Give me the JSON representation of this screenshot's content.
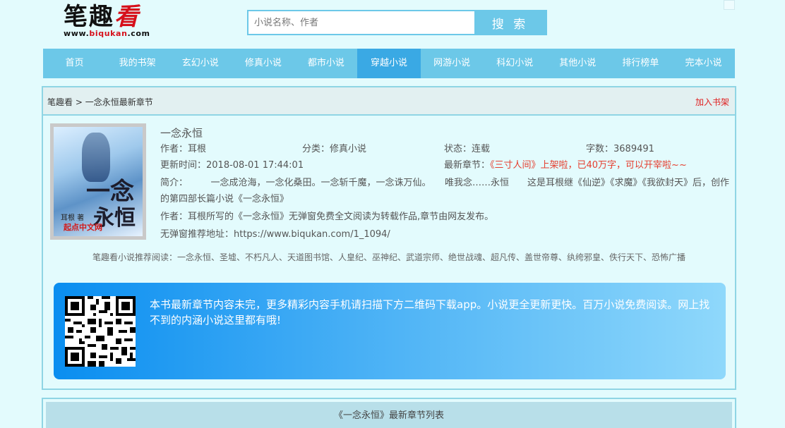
{
  "site": {
    "logo_text_black": "笔趣",
    "logo_text_red": "看",
    "logo_url_prefix": "www.",
    "logo_url_red": "biqukan",
    "logo_url_suffix": ".com"
  },
  "search": {
    "placeholder": "小说名称、作者",
    "button_label": "搜 索"
  },
  "nav": {
    "items": [
      {
        "label": "首页",
        "active": false
      },
      {
        "label": "我的书架",
        "active": false
      },
      {
        "label": "玄幻小说",
        "active": false
      },
      {
        "label": "修真小说",
        "active": false
      },
      {
        "label": "都市小说",
        "active": false
      },
      {
        "label": "穿越小说",
        "active": true
      },
      {
        "label": "网游小说",
        "active": false
      },
      {
        "label": "科幻小说",
        "active": false
      },
      {
        "label": "其他小说",
        "active": false
      },
      {
        "label": "排行榜单",
        "active": false
      },
      {
        "label": "完本小说",
        "active": false
      }
    ]
  },
  "breadcrumb": {
    "home": "笔趣看",
    "separator": " > ",
    "current": "一念永恒最新章节"
  },
  "add_shelf": "加入书架",
  "book": {
    "title": "一念永恒",
    "author_label": "作者：",
    "author": "耳根",
    "category_label": "分类：",
    "category": "修真小说",
    "status_label": "状态：",
    "status": "连载",
    "words_label": "字数：",
    "words": "3689491",
    "updated_label": "更新时间：",
    "updated": "2018-08-01 17:44:01",
    "latest_label": "最新章节：",
    "latest": "《三寸人间》上架啦，已40万字，可以开宰啦~~",
    "intro": "简介：　　　一念成沧海，一念化桑田。一念斩千魔，一念诛万仙。　　唯我念……永恒　　这是耳根继《仙逆》《求魔》《我欲封天》后，创作的第四部长篇小说《一念永恒》",
    "author_note": "作者：耳根所写的《一念永恒》无弹窗免费全文阅读为转载作品,章节由网友发布。",
    "recommend_url": "无弹窗推荐地址：https://www.biqukan.com/1_1094/",
    "cover_title_1": "一念",
    "cover_title_2": "永恒",
    "cover_author": "耳根 著",
    "cover_site": "起点中文网"
  },
  "recommend_reading": "笔趣看小说推荐阅读：一念永恒、圣墟、不朽凡人、天道图书馆、人皇纪、巫神纪、武道宗师、绝世战魂、超凡传、盖世帝尊、纨绔邪皇、佚行天下、恐怖广播",
  "app_banner": {
    "text": "本书最新章节内容未完，更多精彩内容手机请扫描下方二维码下载app。小说更全更新更快。百万小说免费阅读。网上找不到的内涵小说这里都有哦!"
  },
  "chapter_list": {
    "header": "《一念永恒》最新章节列表"
  },
  "colors": {
    "nav_bg": "#6cc8e8",
    "nav_active": "#3aa9e4",
    "page_bg": "#e3fbfd",
    "accent_red": "#e53e2e"
  }
}
